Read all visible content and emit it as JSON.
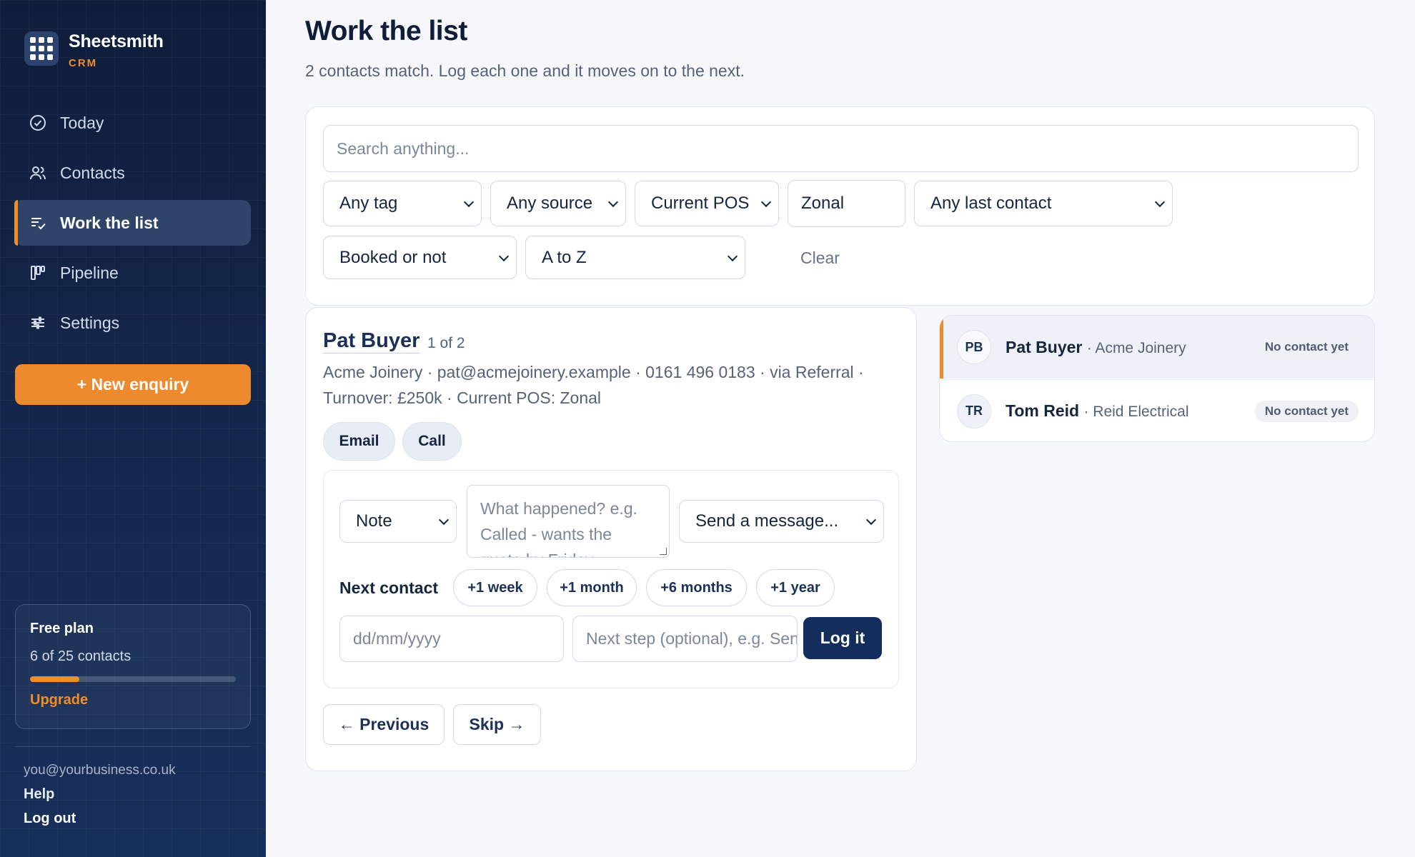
{
  "brand": {
    "name": "Sheetsmith",
    "tag": "CRM"
  },
  "sidebar": {
    "nav": [
      {
        "label": "Today",
        "icon": "check-circle-icon"
      },
      {
        "label": "Contacts",
        "icon": "users-icon"
      },
      {
        "label": "Work the list",
        "icon": "list-check-icon",
        "active": true
      },
      {
        "label": "Pipeline",
        "icon": "kanban-icon"
      },
      {
        "label": "Settings",
        "icon": "sliders-icon"
      }
    ],
    "new_enquiry": "+ New enquiry",
    "plan": {
      "title": "Free plan",
      "count": "6 of 25 contacts",
      "progress": 0.24,
      "upgrade": "Upgrade"
    },
    "footer": {
      "email": "you@yourbusiness.co.uk",
      "help": "Help",
      "logout": "Log out"
    }
  },
  "page": {
    "title": "Work the list",
    "subtitle": "2 contacts match. Log each one and it moves on to the next."
  },
  "filters": {
    "search_placeholder": "Search anything...",
    "tag": "Any tag",
    "source": "Any source",
    "pos_field": "Current POS",
    "pos_value": "Zonal",
    "last_contact": "Any last contact",
    "booked": "Booked or not",
    "sort": "A to Z",
    "clear": "Clear"
  },
  "detail": {
    "name": "Pat Buyer",
    "position": "1 of 2",
    "meta": "Acme Joinery · pat@acmejoinery.example · 0161 496 0183 · via Referral · Turnover: £250k · Current POS: Zonal",
    "email_btn": "Email",
    "call_btn": "Call",
    "log": {
      "type": "Note",
      "textarea_placeholder": "What happened? e.g. Called - wants the quote by Friday",
      "message": "Send a message...",
      "next_label": "Next contact",
      "chips": [
        "+1 week",
        "+1 month",
        "+6 months",
        "+1 year"
      ],
      "date_placeholder": "dd/mm/yyyy",
      "next_step_placeholder": "Next step (optional), e.g. Send quote",
      "log_btn": "Log it"
    },
    "prev_btn": "← Previous",
    "skip_btn": "Skip →"
  },
  "list": [
    {
      "initials": "PB",
      "name": "Pat Buyer",
      "company": "· Acme Joinery",
      "status": "No contact yet",
      "selected": true
    },
    {
      "initials": "TR",
      "name": "Tom Reid",
      "company": "· Reid Electrical",
      "status": "No contact yet",
      "selected": false
    }
  ]
}
